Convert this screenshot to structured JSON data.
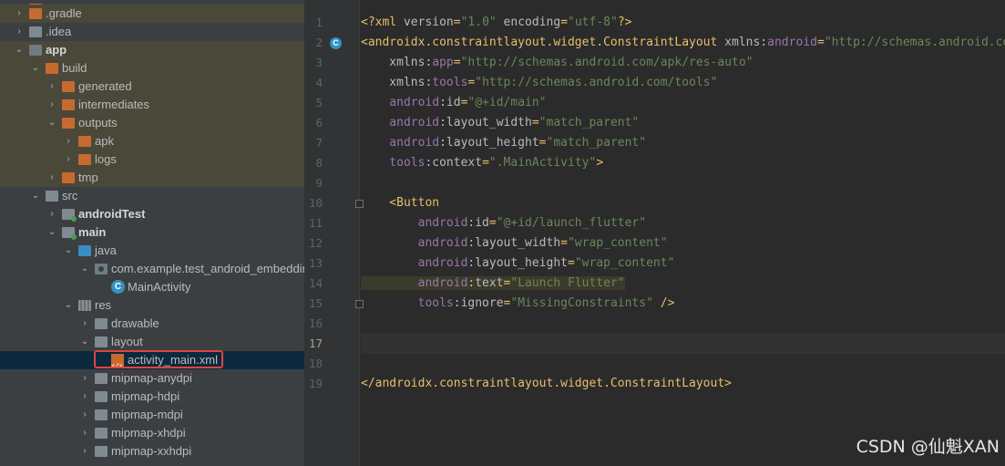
{
  "tree": {
    "items": [
      {
        "label": "",
        "arrow": "",
        "icon": "f-orange",
        "indent": 0,
        "bold": false,
        "style": "topcut"
      },
      {
        "label": ".gradle",
        "arrow": "›",
        "icon": "f-orange",
        "indent": 0,
        "bold": false,
        "style": "hl"
      },
      {
        "label": ".idea",
        "arrow": "›",
        "icon": "f-gray",
        "indent": 0,
        "bold": false,
        "style": ""
      },
      {
        "label": "app",
        "arrow": "⌄",
        "icon": "f-mod",
        "indent": 0,
        "bold": true,
        "style": "hl"
      },
      {
        "label": "build",
        "arrow": "⌄",
        "icon": "f-orange",
        "indent": 1,
        "bold": false,
        "style": "hl"
      },
      {
        "label": "generated",
        "arrow": "›",
        "icon": "f-orange",
        "indent": 2,
        "bold": false,
        "style": "hl"
      },
      {
        "label": "intermediates",
        "arrow": "›",
        "icon": "f-orange",
        "indent": 2,
        "bold": false,
        "style": "hl"
      },
      {
        "label": "outputs",
        "arrow": "⌄",
        "icon": "f-orange",
        "indent": 2,
        "bold": false,
        "style": "hl"
      },
      {
        "label": "apk",
        "arrow": "›",
        "icon": "f-orange",
        "indent": 3,
        "bold": false,
        "style": "hl"
      },
      {
        "label": "logs",
        "arrow": "›",
        "icon": "f-orange",
        "indent": 3,
        "bold": false,
        "style": "hl"
      },
      {
        "label": "tmp",
        "arrow": "›",
        "icon": "f-orange",
        "indent": 2,
        "bold": false,
        "style": "hl"
      },
      {
        "label": "src",
        "arrow": "⌄",
        "icon": "f-gray",
        "indent": 1,
        "bold": false,
        "style": ""
      },
      {
        "label": "androidTest",
        "arrow": "›",
        "icon": "f-gray f-greendot",
        "indent": 2,
        "bold": true,
        "style": ""
      },
      {
        "label": "main",
        "arrow": "⌄",
        "icon": "f-gray f-greendot",
        "indent": 2,
        "bold": true,
        "style": ""
      },
      {
        "label": "java",
        "arrow": "⌄",
        "icon": "f-blue",
        "indent": 3,
        "bold": false,
        "style": ""
      },
      {
        "label": "com.example.test_android_embedding",
        "arrow": "⌄",
        "icon": "f-pkg",
        "indent": 4,
        "bold": false,
        "style": ""
      },
      {
        "label": "MainActivity",
        "arrow": "",
        "icon": "c-class",
        "indent": 5,
        "bold": false,
        "style": ""
      },
      {
        "label": "res",
        "arrow": "⌄",
        "icon": "f-res",
        "indent": 3,
        "bold": false,
        "style": ""
      },
      {
        "label": "drawable",
        "arrow": "›",
        "icon": "f-gray",
        "indent": 4,
        "bold": false,
        "style": ""
      },
      {
        "label": "layout",
        "arrow": "⌄",
        "icon": "f-gray",
        "indent": 4,
        "bold": false,
        "style": ""
      },
      {
        "label": "activity_main.xml",
        "arrow": "",
        "icon": "xml-ico",
        "indent": 5,
        "bold": false,
        "style": "sel"
      },
      {
        "label": "mipmap-anydpi",
        "arrow": "›",
        "icon": "f-gray",
        "indent": 4,
        "bold": false,
        "style": ""
      },
      {
        "label": "mipmap-hdpi",
        "arrow": "›",
        "icon": "f-gray",
        "indent": 4,
        "bold": false,
        "style": ""
      },
      {
        "label": "mipmap-mdpi",
        "arrow": "›",
        "icon": "f-gray",
        "indent": 4,
        "bold": false,
        "style": ""
      },
      {
        "label": "mipmap-xhdpi",
        "arrow": "›",
        "icon": "f-gray",
        "indent": 4,
        "bold": false,
        "style": ""
      },
      {
        "label": "mipmap-xxhdpi",
        "arrow": "›",
        "icon": "f-gray",
        "indent": 4,
        "bold": false,
        "style": ""
      }
    ]
  },
  "editor": {
    "current_line": 17,
    "lines": [
      [
        [
          "pun",
          "<?"
        ],
        [
          "tag",
          "xml "
        ],
        [
          "attr",
          "version"
        ],
        [
          "pun",
          "="
        ],
        [
          "str",
          "\"1.0\""
        ],
        [
          "attr",
          " encoding"
        ],
        [
          "pun",
          "="
        ],
        [
          "str",
          "\"utf-8\""
        ],
        [
          "pun",
          "?>"
        ]
      ],
      [
        [
          "tag",
          "<androidx.constraintlayout.widget.ConstraintLayout "
        ],
        [
          "attr",
          "xmlns:"
        ],
        [
          "ns",
          "android"
        ],
        [
          "pun",
          "="
        ],
        [
          "str",
          "\"http://schemas.android.com/apk/res/android\""
        ]
      ],
      [
        [
          "attr",
          "    xmlns:"
        ],
        [
          "ns",
          "app"
        ],
        [
          "pun",
          "="
        ],
        [
          "str",
          "\"http://schemas.android.com/apk/res-auto\""
        ]
      ],
      [
        [
          "attr",
          "    xmlns:"
        ],
        [
          "ns",
          "tools"
        ],
        [
          "pun",
          "="
        ],
        [
          "str",
          "\"http://schemas.android.com/tools\""
        ]
      ],
      [
        [
          "ns",
          "    android"
        ],
        [
          "attr",
          ":id"
        ],
        [
          "pun",
          "="
        ],
        [
          "str",
          "\"@+id/main\""
        ]
      ],
      [
        [
          "ns",
          "    android"
        ],
        [
          "attr",
          ":layout_width"
        ],
        [
          "pun",
          "="
        ],
        [
          "str",
          "\"match_parent\""
        ]
      ],
      [
        [
          "ns",
          "    android"
        ],
        [
          "attr",
          ":layout_height"
        ],
        [
          "pun",
          "="
        ],
        [
          "str",
          "\"match_parent\""
        ]
      ],
      [
        [
          "ns",
          "    tools"
        ],
        [
          "attr",
          ":context"
        ],
        [
          "pun",
          "="
        ],
        [
          "str",
          "\".MainActivity\""
        ],
        [
          "tag",
          ">"
        ]
      ],
      [],
      [
        [
          "tag",
          "    <Button"
        ]
      ],
      [
        [
          "ns",
          "        android"
        ],
        [
          "attr",
          ":id"
        ],
        [
          "pun",
          "="
        ],
        [
          "str",
          "\"@+id/launch_flutter\""
        ]
      ],
      [
        [
          "ns",
          "        android"
        ],
        [
          "attr",
          ":layout_width"
        ],
        [
          "pun",
          "="
        ],
        [
          "str",
          "\"wrap_content\""
        ]
      ],
      [
        [
          "ns",
          "        android"
        ],
        [
          "attr",
          ":layout_height"
        ],
        [
          "pun",
          "="
        ],
        [
          "str",
          "\"wrap_content\""
        ]
      ],
      [
        [
          "ns",
          "        android"
        ],
        [
          "attr",
          ":text"
        ],
        [
          "pun",
          "="
        ],
        [
          "str",
          "\"Launch Flutter\""
        ]
      ],
      [
        [
          "ns",
          "        tools"
        ],
        [
          "attr",
          ":ignore"
        ],
        [
          "pun",
          "="
        ],
        [
          "str",
          "\"MissingConstraints\""
        ],
        [
          "tag",
          " />"
        ]
      ],
      [],
      [],
      [],
      [
        [
          "tag",
          "</androidx.constraintlayout.widget.ConstraintLayout>"
        ]
      ]
    ]
  },
  "watermark": {
    "text": "CSDN @仙魁XAN"
  }
}
